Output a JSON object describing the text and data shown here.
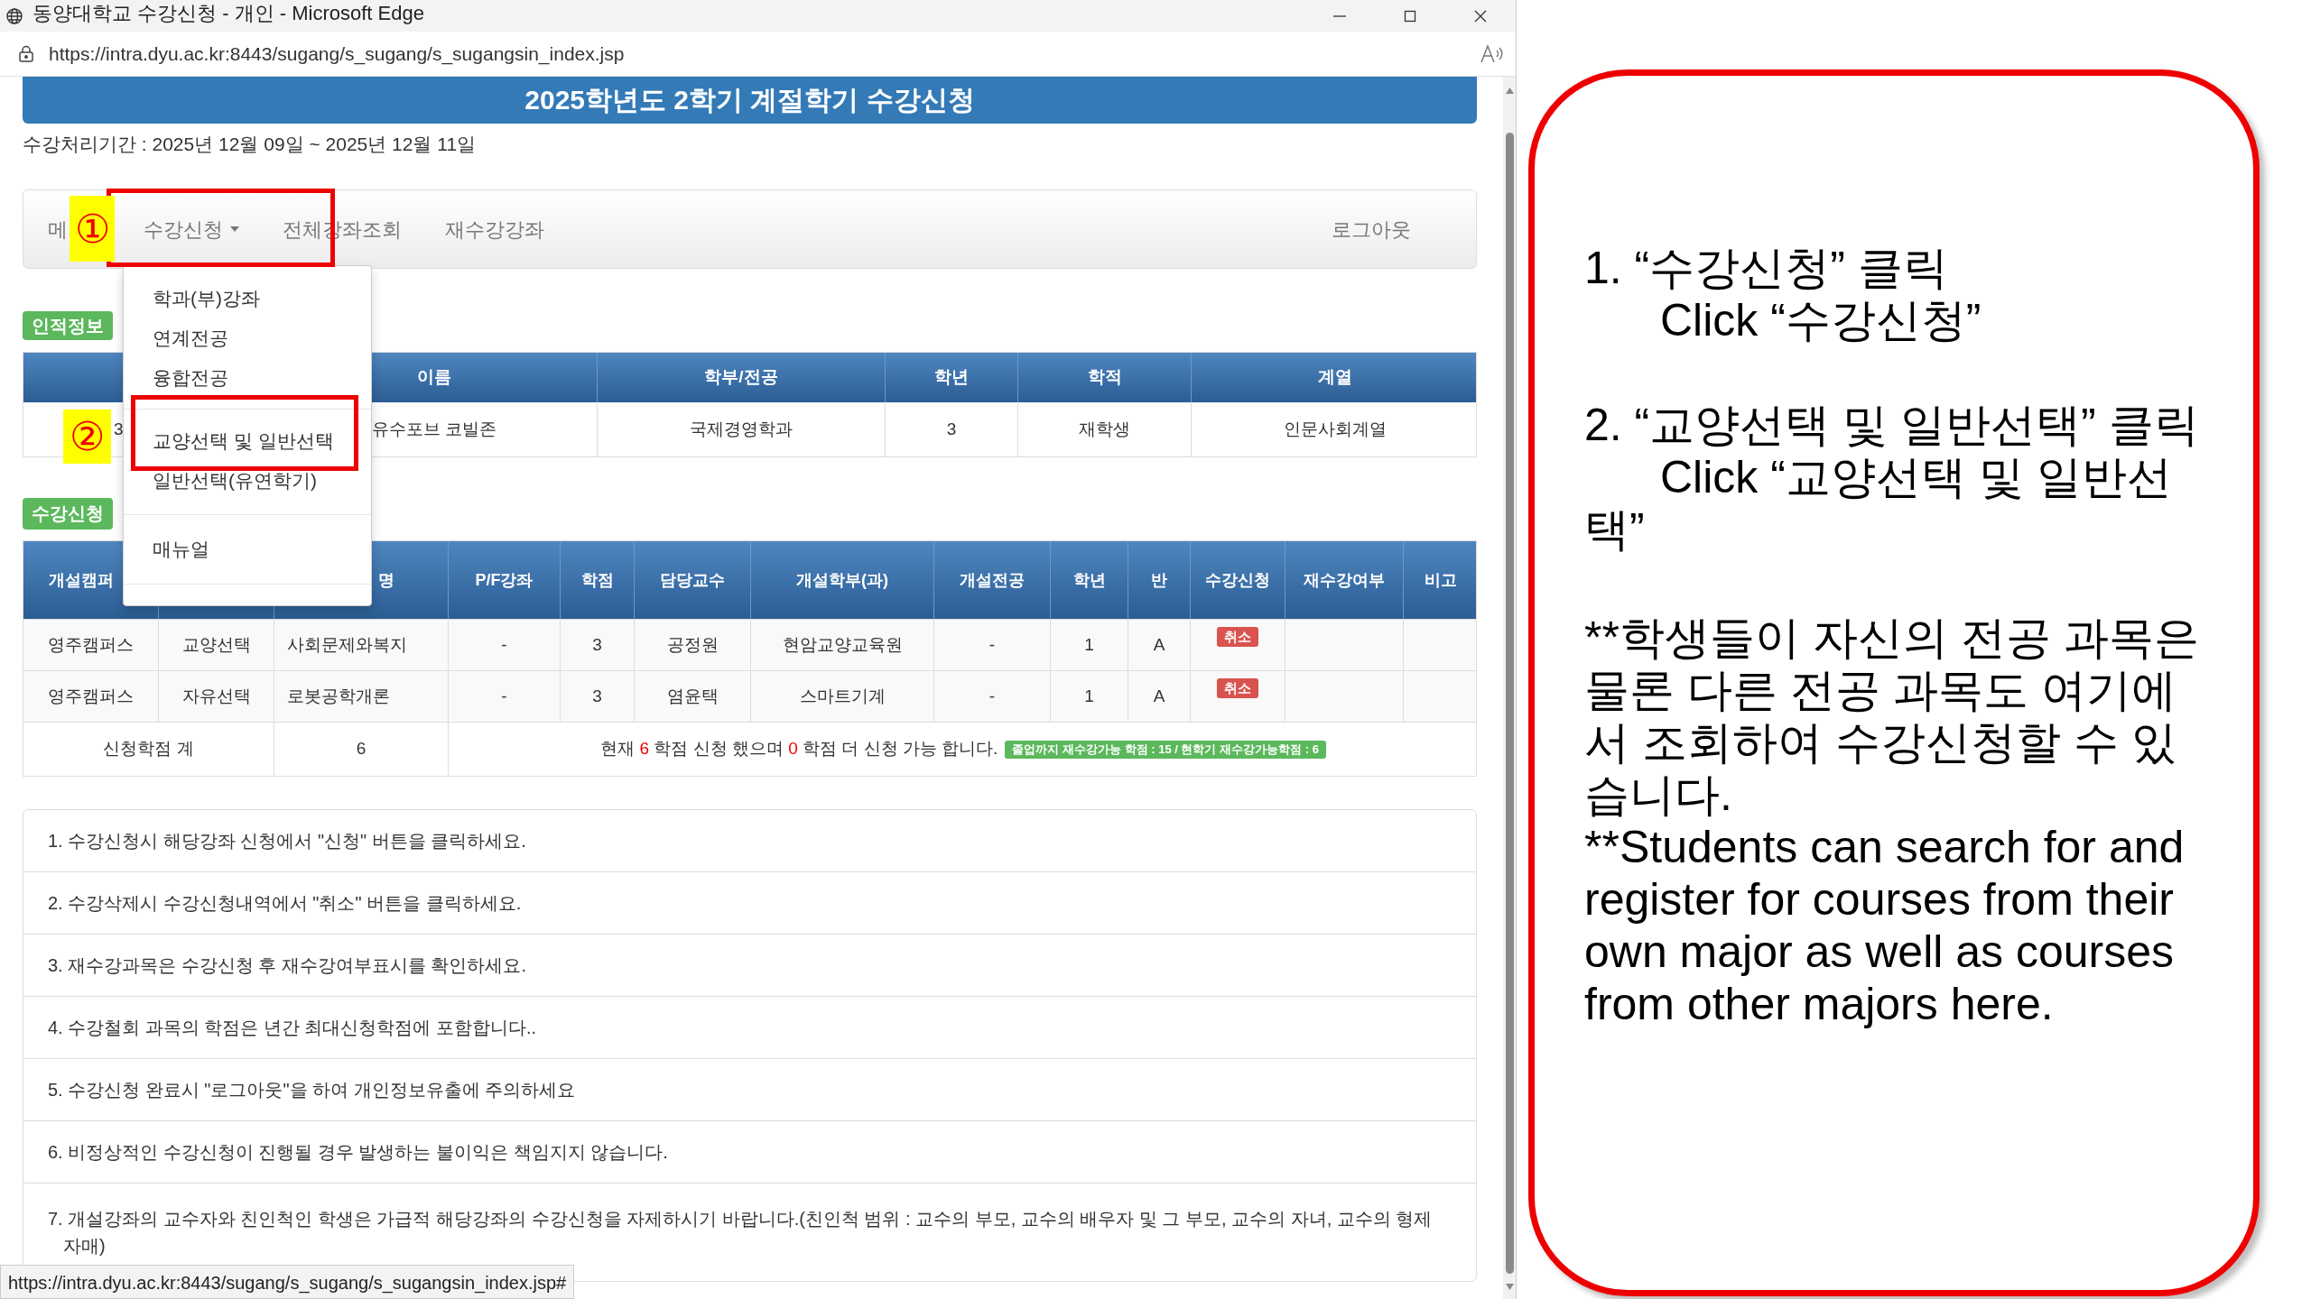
{
  "window": {
    "title": "동양대학교 수강신청 - 개인 - Microsoft Edge",
    "url": "https://intra.dyu.ac.kr:8443/sugang/s_sugang/s_sugangsin_index.jsp"
  },
  "page_header": "2025학년도 2학기 계절학기 수강신청",
  "period": "수강처리기간 : 2025년 12월 09일 ~ 2025년 12월 11일",
  "nav": {
    "items": [
      {
        "label": "메",
        "has_menu": false
      },
      {
        "label": "수강신청",
        "has_menu": true
      },
      {
        "label": "전체강좌조회",
        "has_menu": false
      },
      {
        "label": "재수강강좌",
        "has_menu": false
      }
    ],
    "logout": "로그아웃"
  },
  "dropdown_menu": {
    "groups": [
      {
        "items": [
          "학과(부)강좌",
          "연계전공",
          "융합전공"
        ]
      },
      {
        "items": [
          "교양선택 및 일반선택",
          "일반선택(유연학기)"
        ]
      },
      {
        "items": [
          "매뉴얼"
        ]
      }
    ]
  },
  "personal_info": {
    "label": "인적정보",
    "columns": [
      "이름",
      "학부/전공",
      "학년",
      "학적",
      "계열"
    ],
    "row": [
      "3",
      "유수포브 코빌존",
      "국제경영학과",
      "3",
      "재학생",
      "인문사회계열"
    ]
  },
  "registration": {
    "label": "수강신청",
    "columns": [
      "개설캠퍼",
      "",
      "명",
      "P/F강좌",
      "학점",
      "담당교수",
      "개설학부(과)",
      "개설전공",
      "학년",
      "반",
      "수강신청",
      "재수강여부",
      "비고"
    ],
    "rows": [
      {
        "cells": [
          "영주캠퍼스",
          "교양선택",
          "사회문제와복지",
          "-",
          "3",
          "공정원",
          "현암교양교육원",
          "-",
          "1",
          "A"
        ],
        "action": "취소"
      },
      {
        "cells": [
          "영주캠퍼스",
          "자유선택",
          "로봇공학개론",
          "-",
          "3",
          "염윤택",
          "스마트기계",
          "-",
          "1",
          "A"
        ],
        "action": "취소"
      }
    ],
    "total": {
      "label": "신청학점 계",
      "credits": "6",
      "message": [
        {
          "text": "현재 ",
          "highlight": false
        },
        {
          "text": "6",
          "highlight": true
        },
        {
          "text": " 학점 신청 했으며 ",
          "highlight": false
        },
        {
          "text": "0",
          "highlight": true
        },
        {
          "text": " 학점 더 신청 가능 합니다.",
          "highlight": false
        }
      ],
      "badge": "졸업까지 재수강가능 학점 : 15 / 현학기 재수강가능학점 : 6"
    }
  },
  "notes": [
    "1. 수강신청시 해당강좌 신청에서 \"신청\" 버튼을 클릭하세요.",
    "2. 수강삭제시 수강신청내역에서 \"취소\" 버튼을 클릭하세요.",
    "3. 재수강과목은 수강신청 후 재수강여부표시를 확인하세요.",
    "4. 수강철회 과목의 학점은 년간 최대신청학점에 포함합니다..",
    "5. 수강신청 완료시 \"로그아웃\"을 하여 개인정보유출에 주의하세요",
    "6. 비정상적인 수강신청이 진행될 경우 발생하는 불이익은 책임지지 않습니다.",
    "7. 개설강좌의 교수자와 친인척인 학생은 가급적 해당강좌의 수강신청을 자제하시기 바랍니다.(친인척 범위 : 교수의 부모, 교수의 배우자 및 그 부모, 교수의 자녀, 교수의 형제자매)"
  ],
  "status_url": "https://intra.dyu.ac.kr:8443/sugang/s_sugang/s_sugangsin_index.jsp#",
  "markers": [
    "①",
    "②"
  ],
  "instructions": {
    "steps": [
      {
        "line": "1. “수강신청” 클릭",
        "english": "Click “수강신청”"
      },
      {
        "line": "2. “교양선택 및 일반선택” 클릭",
        "english": "Click “교양선택 및 일반선택”"
      }
    ],
    "note_ko": "**학생들이 자신의 전공 과목은 물론 다른 전공 과목도 여기에서 조회하여 수강신청할 수 있습니다.",
    "note_en": "**Students can search for and register for courses from their own major as well as courses from other majors here."
  }
}
